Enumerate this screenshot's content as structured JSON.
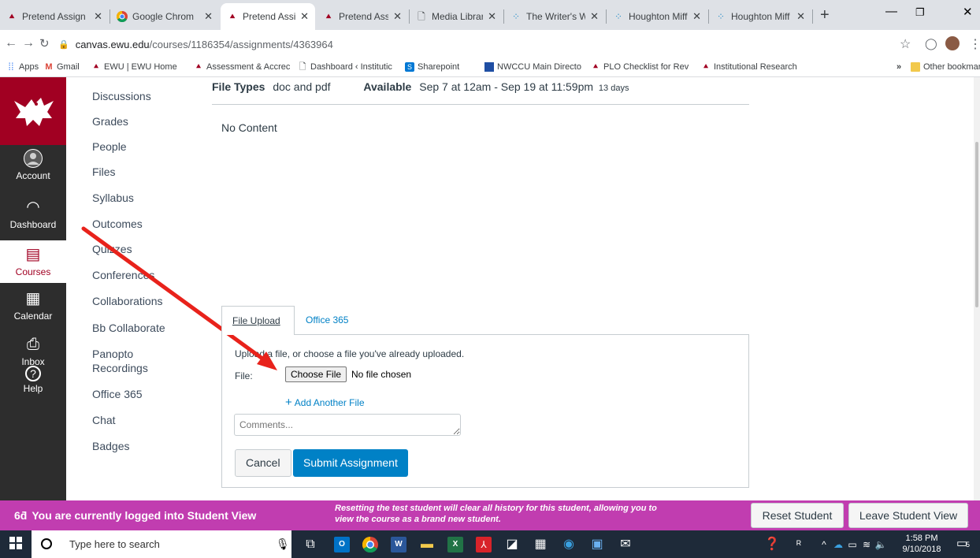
{
  "browser": {
    "tabs": [
      {
        "label": "Pretend Assign",
        "icon": "eagle-icon",
        "active": false
      },
      {
        "label": "Google Chrom",
        "icon": "chrome-icon",
        "active": false
      },
      {
        "label": "Pretend Assign",
        "icon": "eagle-icon",
        "active": true
      },
      {
        "label": "Pretend Assign",
        "icon": "eagle-icon",
        "active": false
      },
      {
        "label": "Media Library",
        "icon": "page-icon",
        "active": false
      },
      {
        "label": "The Writer's W",
        "icon": "dots-icon",
        "active": false
      },
      {
        "label": "Houghton Miff",
        "icon": "dots-icon",
        "active": false
      },
      {
        "label": "Houghton Miff",
        "icon": "dots-icon",
        "active": false
      }
    ],
    "url_host": "canvas.ewu.edu",
    "url_path": "/courses/1186354/assignments/4363964",
    "bookmarks": [
      {
        "label": "Apps",
        "icon": "apps-icon"
      },
      {
        "label": "Gmail",
        "icon": "gmail-icon"
      },
      {
        "label": "EWU | EWU Home",
        "icon": "eagle-icon"
      },
      {
        "label": "Assessment & Accrec",
        "icon": "eagle-icon"
      },
      {
        "label": "Dashboard ‹ Institutic",
        "icon": "page-icon"
      },
      {
        "label": "Sharepoint",
        "icon": "sharepoint-icon"
      },
      {
        "label": "NWCCU Main Directo",
        "icon": "nwccu-icon"
      },
      {
        "label": "PLO Checklist for Rev",
        "icon": "eagle-icon"
      },
      {
        "label": "Institutional Research",
        "icon": "eagle-icon"
      }
    ],
    "bookmarks_overflow": "»",
    "other_bookmarks": "Other bookmarks"
  },
  "global_nav": [
    {
      "label": "Account",
      "icon": "avatar-icon"
    },
    {
      "label": "Dashboard",
      "icon": "dashboard-icon"
    },
    {
      "label": "Courses",
      "icon": "courses-icon",
      "active": true
    },
    {
      "label": "Calendar",
      "icon": "calendar-icon"
    },
    {
      "label": "Inbox",
      "icon": "inbox-icon"
    },
    {
      "label": "Help",
      "icon": "help-icon"
    }
  ],
  "course_nav": [
    "Discussions",
    "Grades",
    "People",
    "Files",
    "Syllabus",
    "Outcomes",
    "Quizzes",
    "Conferences",
    "Collaborations",
    "Bb Collaborate",
    "Panopto Recordings",
    "Office 365",
    "Chat",
    "Badges"
  ],
  "assignment": {
    "file_types_label": "File Types",
    "file_types_value": "doc and pdf",
    "available_label": "Available",
    "available_value": "Sep 7 at 12am - Sep 19 at 11:59pm",
    "available_days": "13 days",
    "no_content": "No Content"
  },
  "submission": {
    "tabs": [
      "File Upload",
      "Office 365"
    ],
    "instructions": "Upload a file, or choose a file you've already uploaded.",
    "file_label": "File:",
    "choose_file": "Choose File",
    "no_file": "No file chosen",
    "add_another": "Add Another File",
    "comments_placeholder": "Comments...",
    "cancel": "Cancel",
    "submit": "Submit Assignment"
  },
  "student_view": {
    "message": "You are currently logged into Student View",
    "note": "Resetting the test student will clear all history for this student, allowing you to view the course as a brand new student.",
    "reset_button": "Reset Student",
    "leave_button": "Leave Student View"
  },
  "taskbar": {
    "search_placeholder": "Type here to search",
    "time": "1:58 PM",
    "date": "9/10/2018",
    "notification_count": "5"
  },
  "colors": {
    "eagle_red": "#a10022",
    "canvas_blue": "#0081c6",
    "student_view_pink": "#c13db0",
    "annotation_arrow": "#e8221b"
  }
}
